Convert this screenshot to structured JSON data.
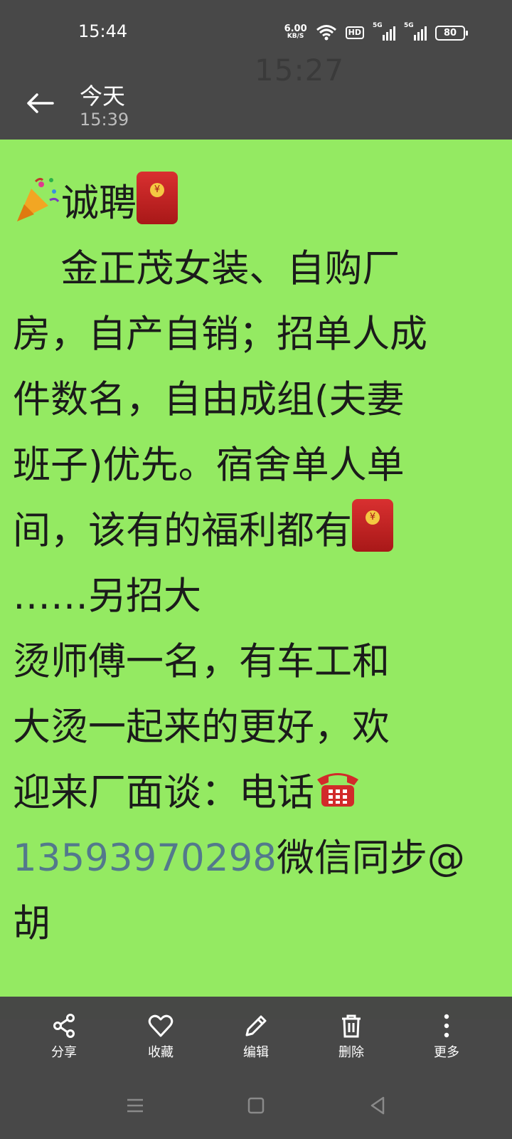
{
  "status_bar": {
    "time": "15:44",
    "net_speed": "6.00",
    "net_unit": "KB/S",
    "hd_label": "HD",
    "sim1_label": "5G",
    "sim2_label": "5G",
    "battery": "80"
  },
  "ghost_time": "15:27",
  "header": {
    "title": "今天",
    "subtitle": "15:39"
  },
  "note": {
    "line1": "诚聘",
    "line2": "    金正茂女装、自购厂",
    "line3": "房，自产自销；招单人成",
    "line4": "件数名，自由成组(夫妻",
    "line5": "班子)优先。宿舍单人单",
    "line6": "间，该有的福利都有",
    "line7": "……另招大",
    "line8": "烫师傅一名，有车工和",
    "line9": "大烫一起来的更好，欢",
    "line10": "迎来厂面谈：电话",
    "phone": "13593970298",
    "line11_after": "微信同步@",
    "line12": "胡"
  },
  "toolbar": {
    "share": "分享",
    "favorite": "收藏",
    "edit": "编辑",
    "delete": "删除",
    "more": "更多"
  },
  "colors": {
    "background": "#484848",
    "note_bg": "#94ea62",
    "phone_link": "#53798c"
  }
}
